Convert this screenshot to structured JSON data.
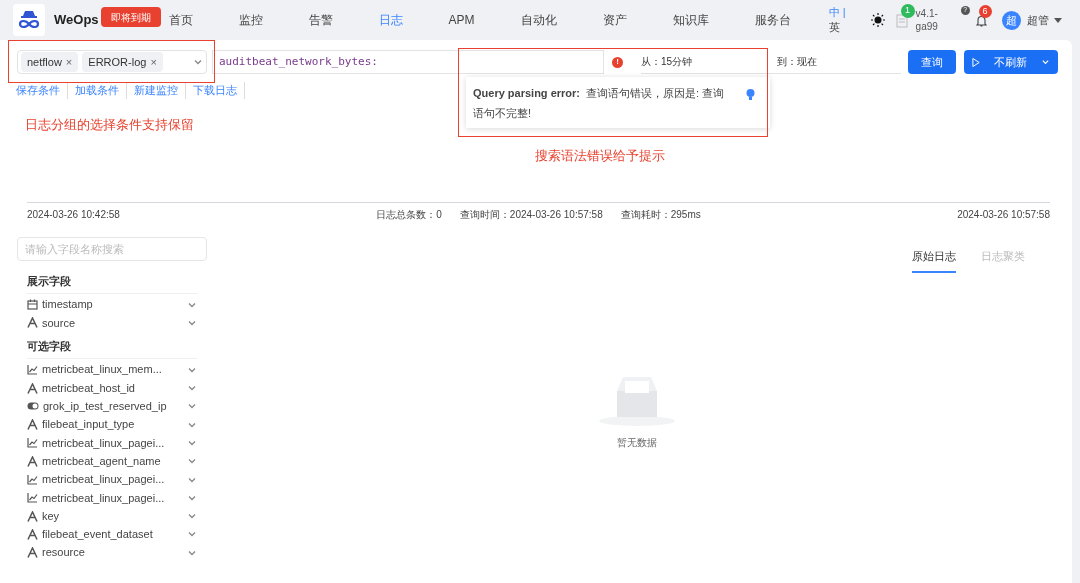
{
  "header": {
    "brand": "WeOps",
    "badge": "即将到期",
    "nav": [
      {
        "label": "首页",
        "selected": false
      },
      {
        "label": "监控",
        "selected": false
      },
      {
        "label": "告警",
        "selected": false
      },
      {
        "label": "日志",
        "selected": true
      },
      {
        "label": "APM",
        "selected": false
      },
      {
        "label": "自动化",
        "selected": false
      },
      {
        "label": "资产",
        "selected": false
      },
      {
        "label": "知识库",
        "selected": false
      },
      {
        "label": "服务台",
        "selected": false
      }
    ],
    "lang": [
      {
        "label": "中 |",
        "selected": true
      },
      {
        "label": "英",
        "selected": false
      }
    ],
    "notice_count": "1",
    "version": "v4.1-ga99",
    "help": "?",
    "alert_count": "6",
    "avatar": "超",
    "user": "超管"
  },
  "query": {
    "tags": [
      "netflow",
      "ERROR-log"
    ],
    "tag_remove": "×",
    "text": "auditbeat_network_bytes:",
    "error_icon": "!",
    "from_label": "从：",
    "from": "15分钟",
    "to_label": "到：",
    "to": "现在",
    "search_button": "查询",
    "refresh_button": "不刷新"
  },
  "actions": [
    "保存条件",
    "加载条件",
    "新建监控",
    "下载日志"
  ],
  "error_popover": {
    "title": "Query parsing error:",
    "message": "查询语句错误，原因是: 查询语句不完整!"
  },
  "annotations": [
    {
      "text": "日志分组的选择条件支持保留"
    },
    {
      "text": "搜索语法错误给予提示"
    }
  ],
  "timeline": {
    "start": "2024-03-26 10:42:58",
    "total": "日志总条数：0",
    "query_time": "查询时间：2024-03-26 10:57:58",
    "elapsed": "查询耗时：295ms",
    "end": "2024-03-26 10:57:58"
  },
  "field_search": {
    "placeholder": "请输入字段名称搜索"
  },
  "field_groups": [
    {
      "title": "展示字段",
      "fields": [
        {
          "kind": "date",
          "name": "timestamp"
        },
        {
          "kind": "text",
          "name": "source"
        }
      ]
    },
    {
      "title": "可选字段",
      "fields": [
        {
          "kind": "number",
          "name": "metricbeat_linux_mem..."
        },
        {
          "kind": "text",
          "name": "metricbeat_host_id"
        },
        {
          "kind": "bool",
          "name": "grok_ip_test_reserved_ip"
        },
        {
          "kind": "text",
          "name": "filebeat_input_type"
        },
        {
          "kind": "number",
          "name": "metricbeat_linux_pagei..."
        },
        {
          "kind": "text",
          "name": "metricbeat_agent_name"
        },
        {
          "kind": "number",
          "name": "metricbeat_linux_pagei..."
        },
        {
          "kind": "number",
          "name": "metricbeat_linux_pagei..."
        },
        {
          "kind": "text",
          "name": "key"
        },
        {
          "kind": "text",
          "name": "filebeat_event_dataset"
        },
        {
          "kind": "text",
          "name": "resource"
        }
      ]
    }
  ],
  "result_tabs": [
    {
      "label": "原始日志",
      "selected": true
    },
    {
      "label": "日志聚类",
      "selected": false
    }
  ],
  "empty_text": "暂无数据"
}
